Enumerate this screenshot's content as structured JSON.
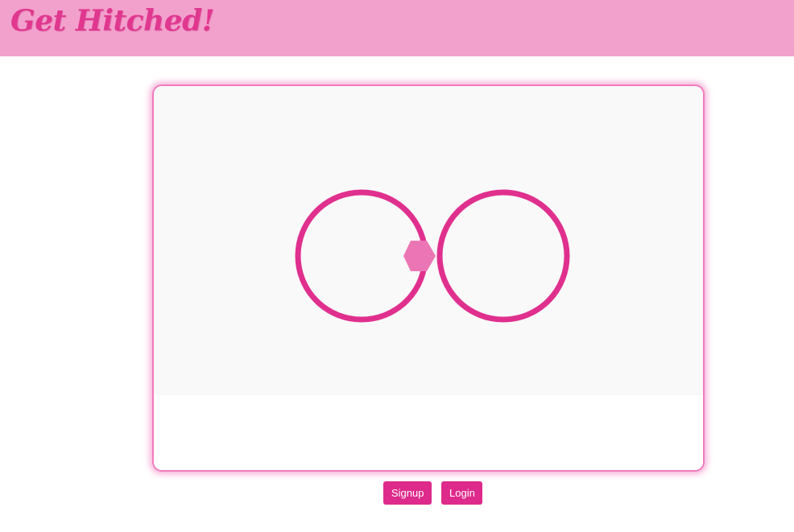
{
  "header": {
    "brand": "Get Hitched!"
  },
  "hero": {
    "illustration": "wedding-rings-icon"
  },
  "actions": {
    "signup_label": "Signup",
    "login_label": "Login"
  },
  "colors": {
    "header_bg": "#f2a1cc",
    "brand_text": "#e0378f",
    "ring": "#e0308e",
    "gem": "#ec76b5",
    "button_bg": "#de2a8b",
    "card_border": "#f07cbd",
    "image_bg": "#f9f9f9"
  }
}
